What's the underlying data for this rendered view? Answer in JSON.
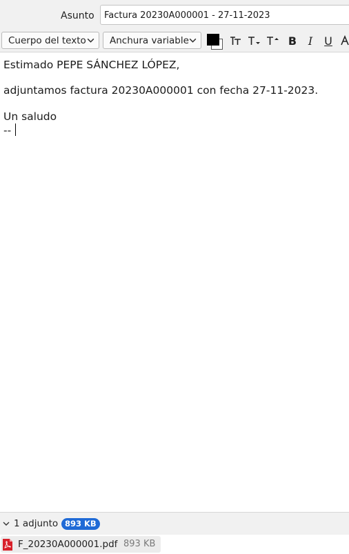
{
  "header": {
    "subject_label": "Asunto",
    "subject_value": "Factura 20230A000001 - 27-11-2023"
  },
  "toolbar": {
    "paragraph_format": "Cuerpo del texto",
    "font": "Anchura variable",
    "text_color": "#000000",
    "background_color": "#ffffff",
    "bold_label": "B",
    "italic_label": "I",
    "underline_label": "U"
  },
  "body": {
    "greeting": "Estimado PEPE SÁNCHEZ LÓPEZ,",
    "message": "adjuntamos factura 20230A000001 con fecha 27-11-2023.",
    "closing": "Un saludo",
    "signature_separator": "--"
  },
  "attachments": {
    "summary": "1 adjunto",
    "total_size": "893 KB",
    "accent_color": "#1f6ad6",
    "items": [
      {
        "name": "F_20230A000001.pdf",
        "size": "893 KB",
        "icon": "pdf-icon"
      }
    ]
  }
}
